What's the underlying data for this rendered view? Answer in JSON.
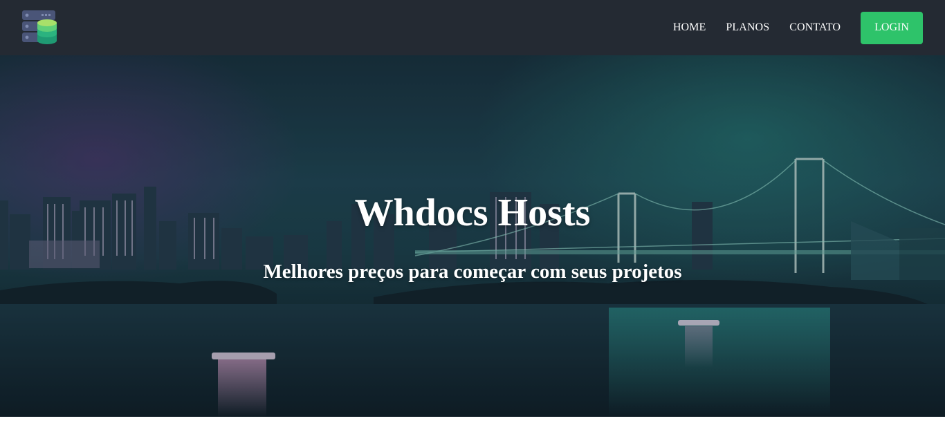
{
  "header": {
    "logo_icon": "server-database-icon",
    "nav": [
      {
        "label": "HOME"
      },
      {
        "label": "PLANOS"
      },
      {
        "label": "CONTATO"
      }
    ],
    "login_label": "LOGIN"
  },
  "hero": {
    "title": "Whdocs Hosts",
    "subtitle": "Melhores preços para começar com seus projetos",
    "background_image": "night-city-bridge-photo"
  },
  "colors": {
    "navbar_bg": "#242a33",
    "accent_green": "#2ec36a",
    "text": "#ffffff"
  }
}
